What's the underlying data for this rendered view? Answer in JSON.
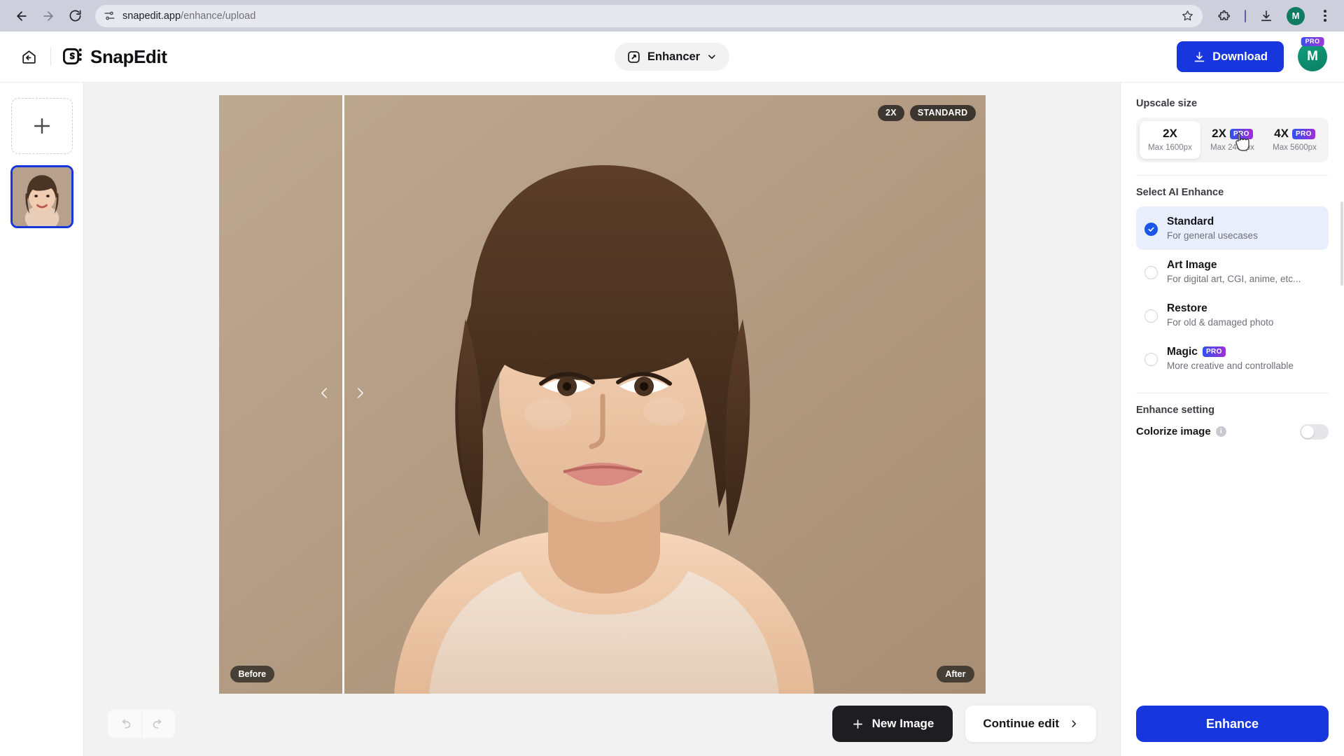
{
  "browser": {
    "url_domain": "snapedit.app",
    "url_path": "/enhance/upload",
    "back_icon": "back-arrow-icon",
    "forward_icon": "forward-arrow-icon",
    "reload_icon": "reload-icon",
    "site_icon": "site-settings-icon",
    "star_icon": "bookmark-star-icon",
    "extensions_icon": "extensions-puzzle-icon",
    "downloads_icon": "downloads-icon",
    "profile_initial": "M",
    "menu_icon": "three-dot-menu-icon"
  },
  "header": {
    "home_icon": "home-back-icon",
    "logo_text": "SnapEdit",
    "mode": {
      "icon": "enhancer-icon",
      "label": "Enhancer",
      "chevron": "chevron-down-icon"
    },
    "download_label": "Download",
    "download_icon": "download-icon",
    "avatar_initial": "M",
    "avatar_badge": "PRO"
  },
  "sidebar": {
    "add_label": "+",
    "thumbnail_name": "portrait-thumbnail"
  },
  "canvas": {
    "badges": [
      "2X",
      "STANDARD"
    ],
    "before_label": "Before",
    "after_label": "After",
    "prev_icon": "chevron-left-icon",
    "next_icon": "chevron-right-icon"
  },
  "bottom": {
    "undo_icon": "undo-icon",
    "redo_icon": "redo-icon",
    "new_image_label": "New Image",
    "new_image_icon": "plus-icon",
    "continue_label": "Continue edit",
    "continue_icon": "chevron-right-icon"
  },
  "panel": {
    "upscale_title": "Upscale size",
    "upscale_options": [
      {
        "size": "2X",
        "max": "Max 1600px",
        "pro": false,
        "selected": true
      },
      {
        "size": "2X",
        "max": "Max 2400px",
        "pro": true,
        "selected": false
      },
      {
        "size": "4X",
        "max": "Max 5600px",
        "pro": true,
        "selected": false
      }
    ],
    "enhance_title": "Select AI Enhance",
    "enhance_options": [
      {
        "name": "Standard",
        "desc": "For general usecases",
        "pro": false,
        "selected": true
      },
      {
        "name": "Art Image",
        "desc": "For digital art, CGI, anime, etc...",
        "pro": false,
        "selected": false
      },
      {
        "name": "Restore",
        "desc": "For old & damaged photo",
        "pro": false,
        "selected": false
      },
      {
        "name": "Magic",
        "desc": "More creative and controllable",
        "pro": true,
        "selected": false
      }
    ],
    "setting_title": "Enhance setting",
    "colorize_label": "Colorize image",
    "colorize_on": false,
    "info_icon": "info-icon",
    "enhance_button": "Enhance",
    "pro_tag": "PRO"
  },
  "colors": {
    "accent_blue": "#1836dd",
    "selected_bg": "#e8eefc",
    "dark_button": "#1d1d22",
    "avatar_green": "#0b7f63"
  }
}
